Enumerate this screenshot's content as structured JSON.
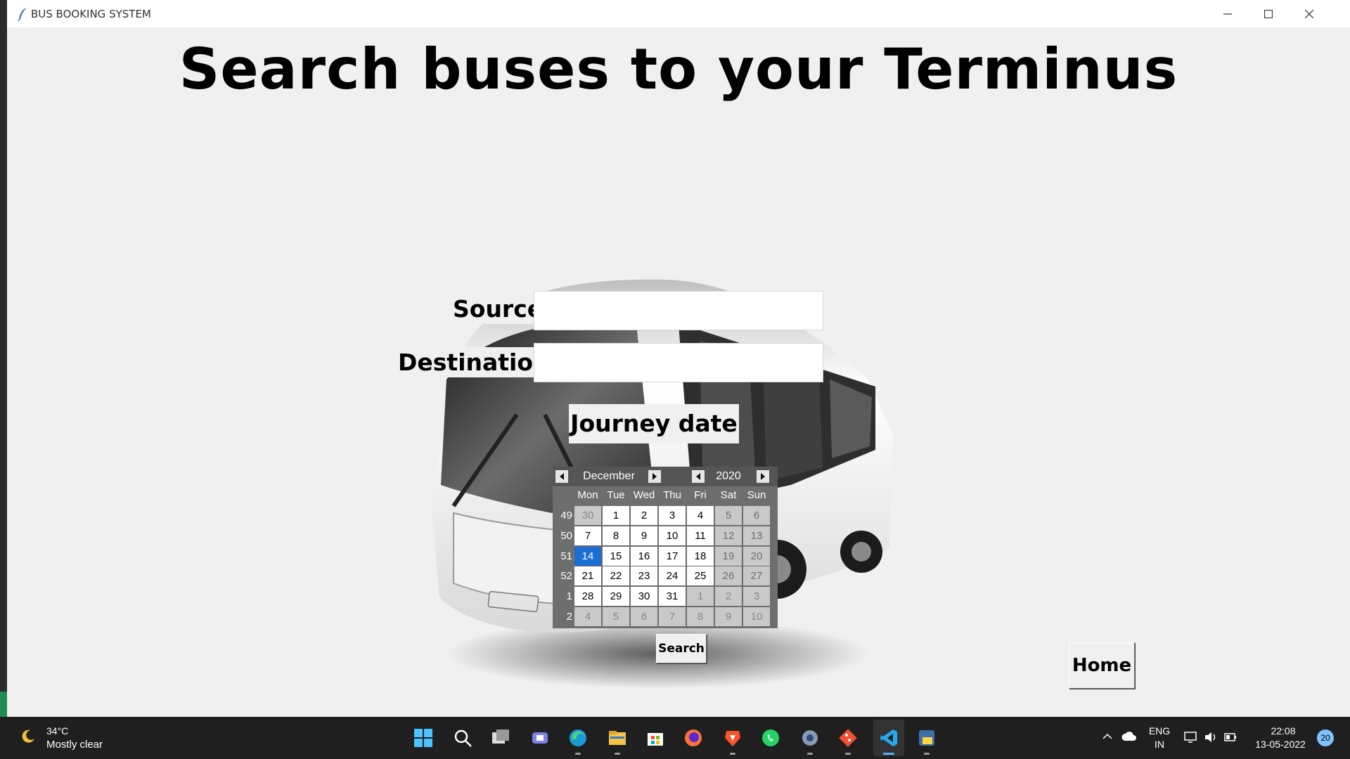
{
  "window": {
    "title": "BUS BOOKING SYSTEM"
  },
  "heading": "Search buses to your Terminus",
  "form": {
    "source_label": "Source",
    "source_value": "",
    "destination_label": "Destination",
    "destination_value": "",
    "journey_label": "Journey date"
  },
  "calendar": {
    "month": "December",
    "year": "2020",
    "day_headers": [
      "Mon",
      "Tue",
      "Wed",
      "Thu",
      "Fri",
      "Sat",
      "Sun"
    ],
    "weeks": [
      {
        "num": "49",
        "days": [
          "30",
          "1",
          "2",
          "3",
          "4",
          "5",
          "6"
        ]
      },
      {
        "num": "50",
        "days": [
          "7",
          "8",
          "9",
          "10",
          "11",
          "12",
          "13"
        ]
      },
      {
        "num": "51",
        "days": [
          "14",
          "15",
          "16",
          "17",
          "18",
          "19",
          "20"
        ]
      },
      {
        "num": "52",
        "days": [
          "21",
          "22",
          "23",
          "24",
          "25",
          "26",
          "27"
        ]
      },
      {
        "num": "1",
        "days": [
          "28",
          "29",
          "30",
          "31",
          "1",
          "2",
          "3"
        ]
      },
      {
        "num": "2",
        "days": [
          "4",
          "5",
          "6",
          "7",
          "8",
          "9",
          "10"
        ]
      }
    ],
    "selected": "14"
  },
  "buttons": {
    "search": "Search",
    "home": "Home"
  },
  "taskbar": {
    "temperature": "34°C",
    "condition": "Mostly clear",
    "lang_top": "ENG",
    "lang_bottom": "IN",
    "time": "22:08",
    "date": "13-05-2022",
    "notification_count": "20",
    "apps": [
      "start-icon",
      "search-icon",
      "task-view-icon",
      "teams-icon",
      "edge-icon",
      "file-explorer-icon",
      "store-icon",
      "firefox-icon",
      "brave-icon",
      "whatsapp-icon",
      "settings-icon",
      "git-icon",
      "vscode-icon",
      "python-icon"
    ]
  }
}
